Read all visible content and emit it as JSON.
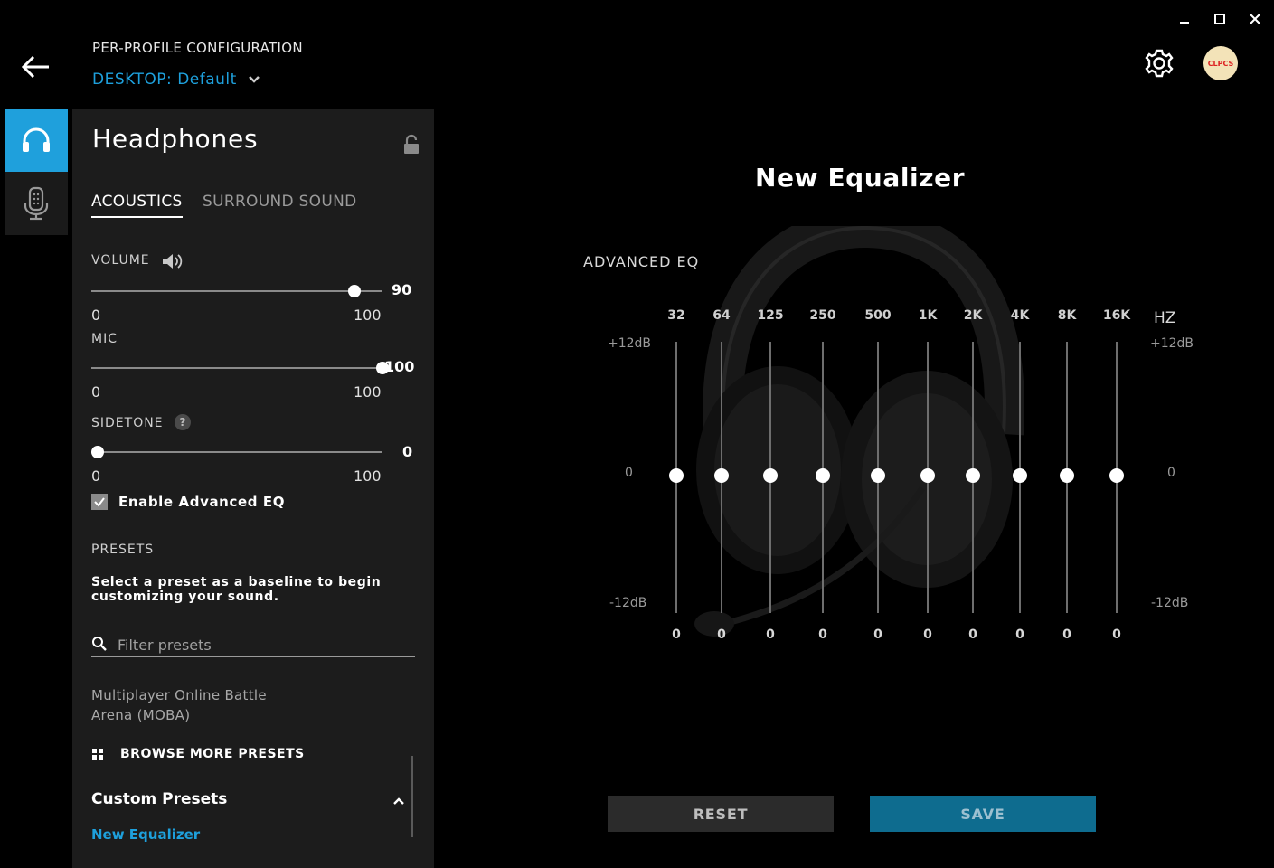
{
  "window": {
    "controls": {
      "minimize_icon": "minimize-icon",
      "maximize_icon": "maximize-icon",
      "close_icon": "close-icon"
    }
  },
  "header": {
    "title": "PER-PROFILE CONFIGURATION",
    "profile_prefix": "DESKTOP:",
    "profile_name": "Default",
    "avatar_text": "CLPCS"
  },
  "rail": {
    "items": [
      {
        "icon": "headphones-icon",
        "active": true
      },
      {
        "icon": "microphone-icon",
        "active": false
      }
    ]
  },
  "panel": {
    "title": "Headphones",
    "tabs": [
      "ACOUSTICS",
      "SURROUND SOUND"
    ],
    "volume": {
      "label": "VOLUME",
      "value": "90",
      "min": "0",
      "max": "100",
      "level": 0.9
    },
    "mic": {
      "label": "MIC",
      "value": "100",
      "min": "0",
      "max": "100",
      "level": 1.0
    },
    "sidetone": {
      "label": "SIDETONE",
      "help": "?",
      "value": "0",
      "min": "0",
      "max": "100",
      "level": 0.0
    },
    "enable_eq": {
      "label": "Enable Advanced EQ",
      "checked": true
    },
    "presets": {
      "heading": "PRESETS",
      "description": "Select a preset as a baseline to begin customizing your sound.",
      "filter_placeholder": "Filter presets",
      "visible_item": "Multiplayer Online Battle Arena (MOBA)",
      "browse_label": "BROWSE MORE PRESETS",
      "custom_heading": "Custom Presets",
      "custom_items": [
        "New Equalizer"
      ]
    }
  },
  "equalizer": {
    "title": "New Equalizer",
    "section_label": "ADVANCED EQ",
    "hz_label": "HZ",
    "db_top": "+12dB",
    "db_mid": "0",
    "db_bottom": "-12dB",
    "bands": [
      {
        "freq": "32",
        "gain": "0"
      },
      {
        "freq": "64",
        "gain": "0"
      },
      {
        "freq": "125",
        "gain": "0"
      },
      {
        "freq": "250",
        "gain": "0"
      },
      {
        "freq": "500",
        "gain": "0"
      },
      {
        "freq": "1K",
        "gain": "0"
      },
      {
        "freq": "2K",
        "gain": "0"
      },
      {
        "freq": "4K",
        "gain": "0"
      },
      {
        "freq": "8K",
        "gain": "0"
      },
      {
        "freq": "16K",
        "gain": "0"
      }
    ],
    "reset_label": "RESET",
    "save_label": "SAVE"
  },
  "colors": {
    "accent": "#1ea0dc",
    "save": "#0e6c8f",
    "panel": "#1c1c1c"
  }
}
